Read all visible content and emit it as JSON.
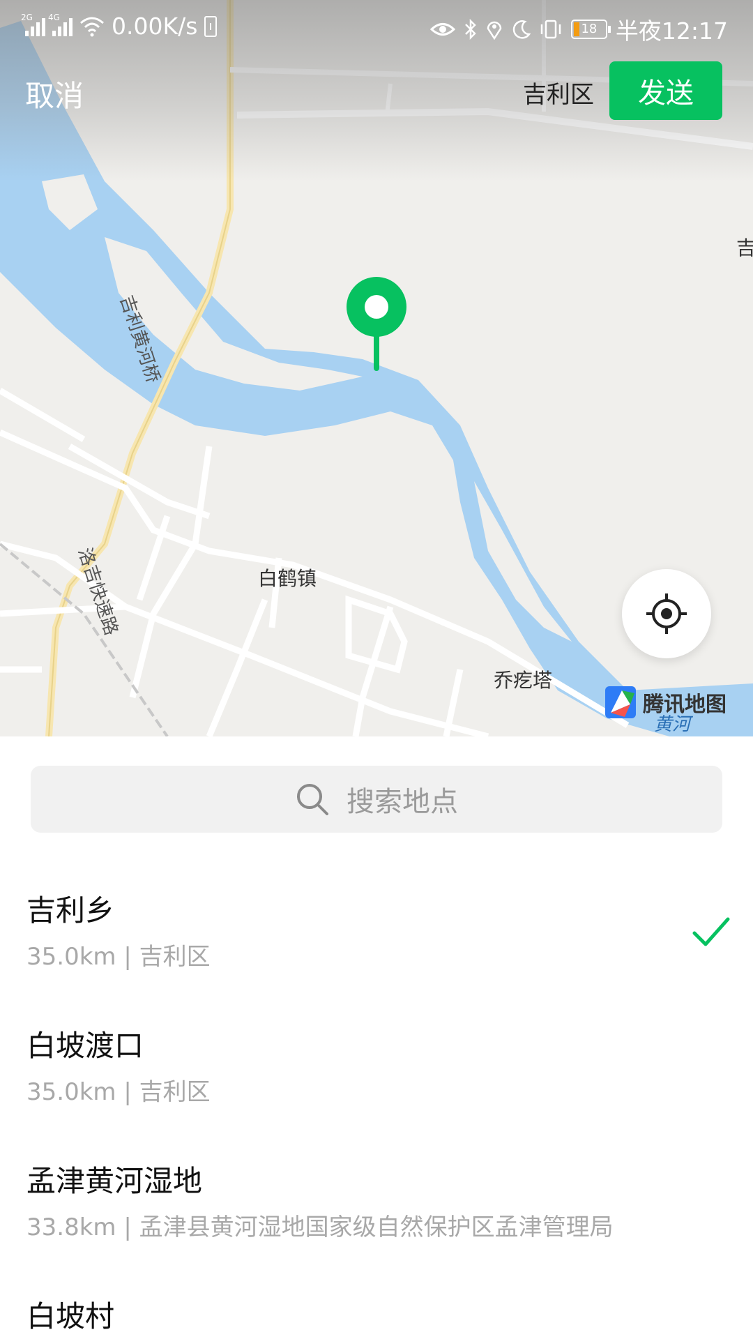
{
  "status_bar": {
    "signal1": "2G",
    "signal2": "4G",
    "speed": "0.00K/s",
    "battery_level": "18",
    "time": "半夜12:17"
  },
  "header": {
    "cancel_label": "取消",
    "region_label": "吉利区",
    "send_label": "发送"
  },
  "map": {
    "labels": {
      "town1": "白鹤镇",
      "town2": "乔疙塔",
      "bridge": "吉利黄河桥",
      "expressway": "洛吉快速路",
      "edge": "吉",
      "river": "黄河"
    },
    "logo_text": "腾讯地图",
    "accent_color": "#07c160",
    "water_color": "#a8d1f2"
  },
  "search": {
    "placeholder": "搜索地点"
  },
  "places": [
    {
      "name": "吉利乡",
      "detail": "35.0km | 吉利区",
      "selected": true
    },
    {
      "name": "白坡渡口",
      "detail": "35.0km | 吉利区",
      "selected": false
    },
    {
      "name": "孟津黄河湿地",
      "detail": "33.8km | 孟津县黄河湿地国家级自然保护区孟津管理局",
      "selected": false
    },
    {
      "name": "白坡村",
      "detail": "",
      "selected": false
    }
  ]
}
